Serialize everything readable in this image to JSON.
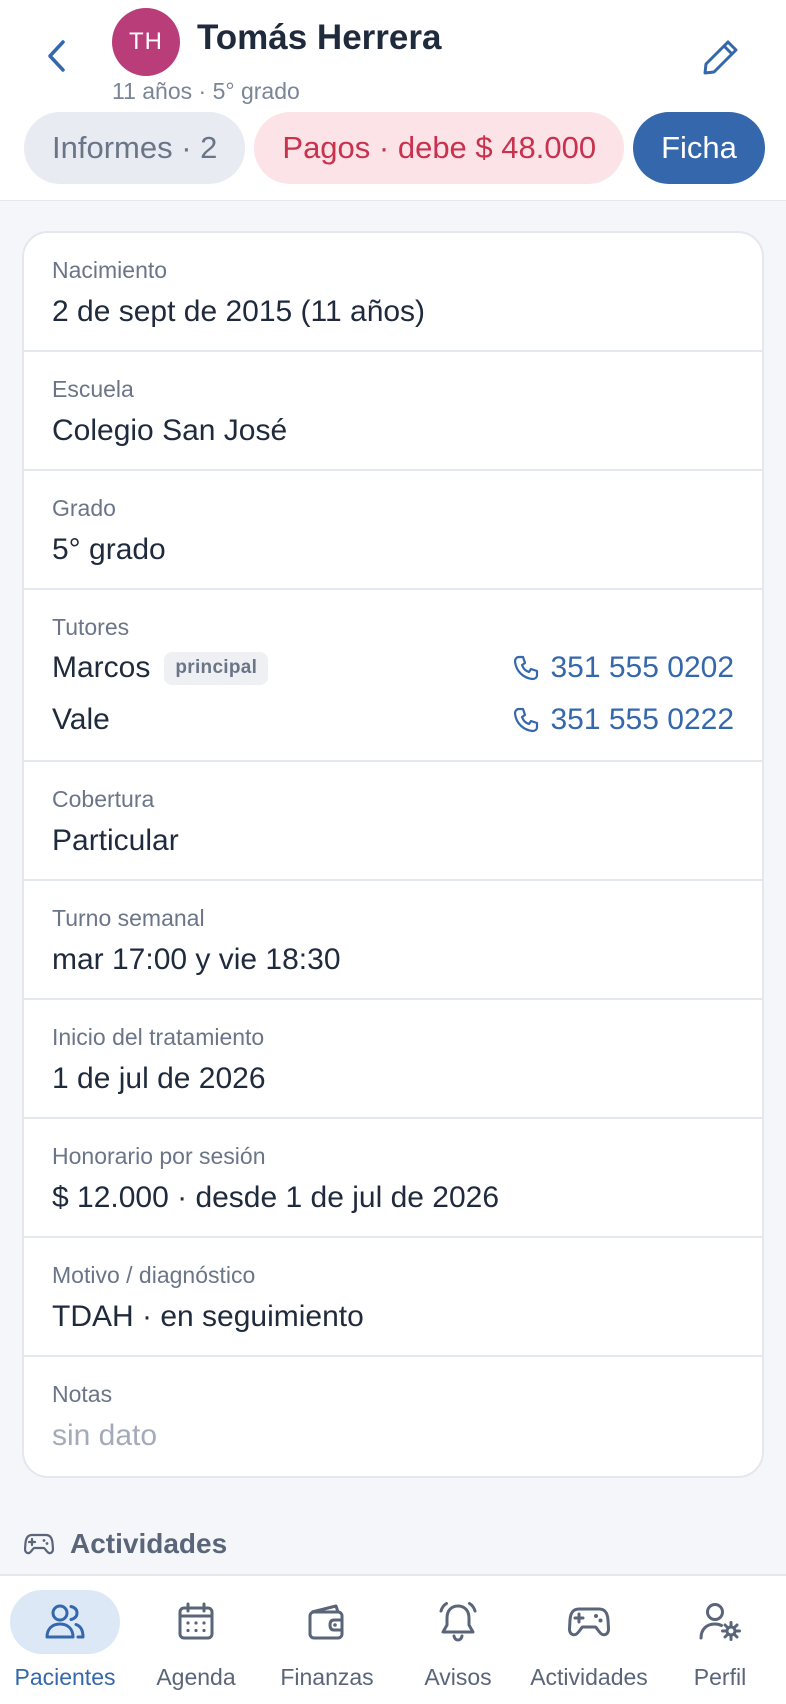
{
  "header": {
    "avatar_initials": "TH",
    "avatar_color": "#b83d79",
    "name": "Tomás Herrera",
    "subtitle": "11 años · 5° grado",
    "back_icon": "chevron-left-icon",
    "edit_icon": "pencil-icon"
  },
  "tabs": [
    {
      "label": "Informes · 2",
      "state": "inactive"
    },
    {
      "label": "Pagos · debe $ 48.000",
      "state": "alert"
    },
    {
      "label": "Ficha",
      "state": "active"
    }
  ],
  "details": {
    "nacimiento": {
      "label": "Nacimiento",
      "value": "2 de sept de 2015 (11 años)"
    },
    "escuela": {
      "label": "Escuela",
      "value": "Colegio San José"
    },
    "grado": {
      "label": "Grado",
      "value": "5° grado"
    },
    "tutores": {
      "label": "Tutores",
      "items": [
        {
          "name": "Marcos",
          "badge": "principal",
          "phone": "351 555 0202"
        },
        {
          "name": "Vale",
          "badge": "",
          "phone": "351 555 0222"
        }
      ]
    },
    "cobertura": {
      "label": "Cobertura",
      "value": "Particular"
    },
    "turno": {
      "label": "Turno semanal",
      "value": "mar 17:00 y vie 18:30"
    },
    "inicio": {
      "label": "Inicio del tratamiento",
      "value": "1 de jul de 2026"
    },
    "honorario": {
      "label": "Honorario por sesión",
      "value": "$ 12.000 · desde 1 de jul de 2026"
    },
    "motivo": {
      "label": "Motivo / diagnóstico",
      "value": "TDAH · en seguimiento"
    },
    "notas": {
      "label": "Notas",
      "value": "sin dato"
    }
  },
  "section": {
    "title": "Actividades",
    "icon": "gamepad-icon"
  },
  "nav": [
    {
      "label": "Pacientes",
      "icon": "users-icon",
      "active": true
    },
    {
      "label": "Agenda",
      "icon": "calendar-icon",
      "active": false
    },
    {
      "label": "Finanzas",
      "icon": "wallet-icon",
      "active": false
    },
    {
      "label": "Avisos",
      "icon": "bell-icon",
      "active": false
    },
    {
      "label": "Actividades",
      "icon": "gamepad-icon",
      "active": false
    },
    {
      "label": "Perfil",
      "icon": "user-settings-icon",
      "active": false
    }
  ],
  "colors": {
    "accent": "#3567ac",
    "alert": "#c9314d",
    "alert_bg": "#fbe3e7",
    "background": "#f4f6fa"
  }
}
